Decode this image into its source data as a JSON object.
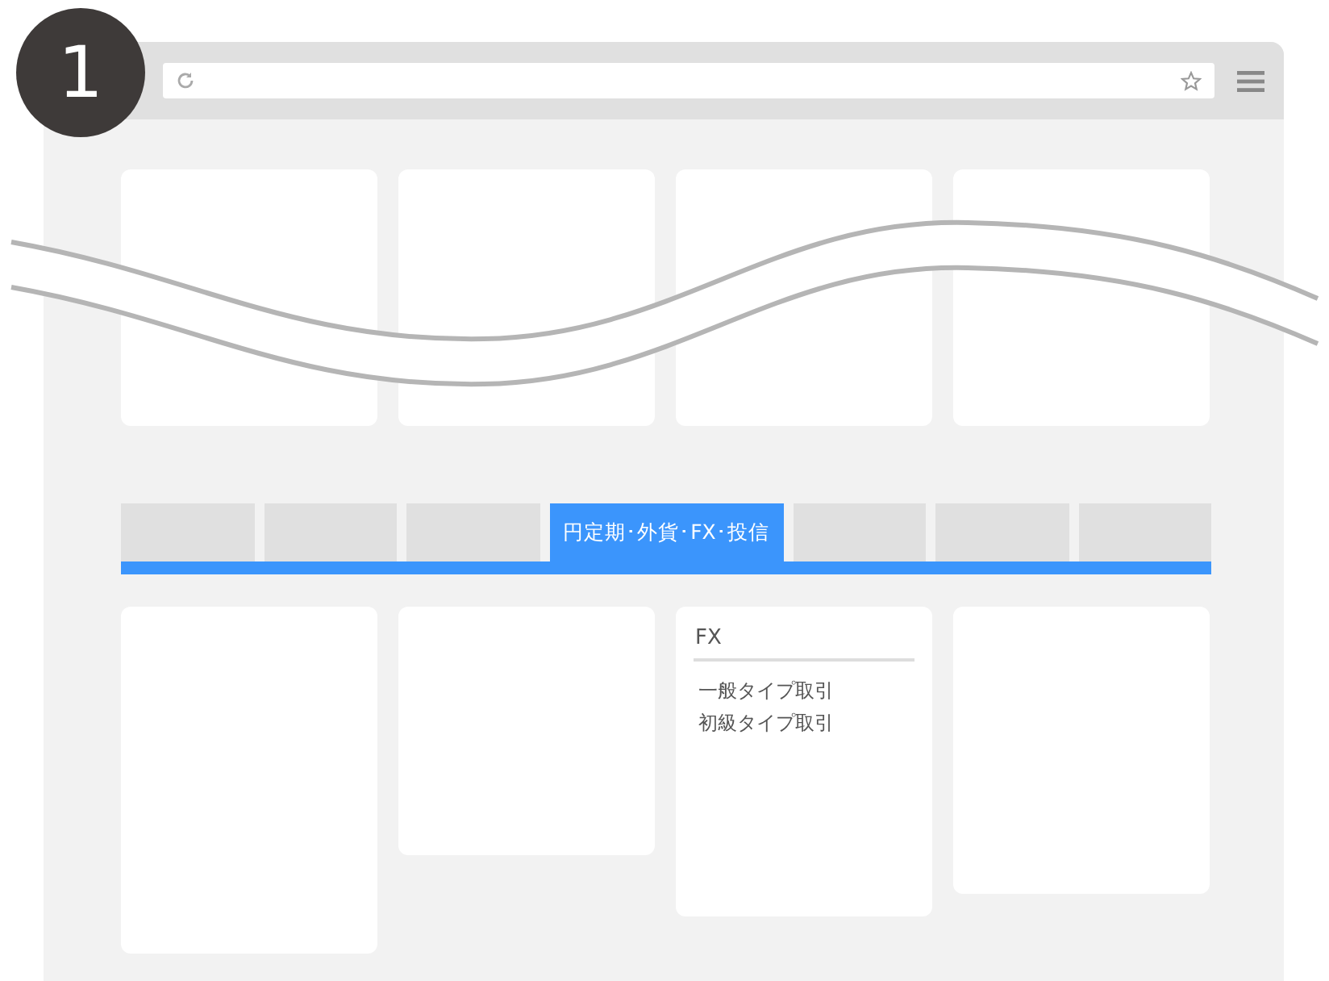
{
  "step_badge": {
    "number": "1"
  },
  "top_cards": [
    {
      "kind": "blank"
    },
    {
      "kind": "blank"
    },
    {
      "kind": "blank"
    },
    {
      "kind": "blank"
    }
  ],
  "tabs": [
    {
      "selected": false
    },
    {
      "selected": false
    },
    {
      "selected": false
    },
    {
      "label": "円定期･外貨･FX･投信",
      "selected": true
    },
    {
      "selected": false
    },
    {
      "selected": false
    },
    {
      "selected": false
    }
  ],
  "bottom_cards": [
    {
      "kind": "blank"
    },
    {
      "kind": "blank"
    },
    {
      "kind": "menu",
      "heading": "FX",
      "links": [
        "一般タイプ取引",
        "初級タイプ取引"
      ]
    },
    {
      "kind": "blank"
    }
  ]
}
